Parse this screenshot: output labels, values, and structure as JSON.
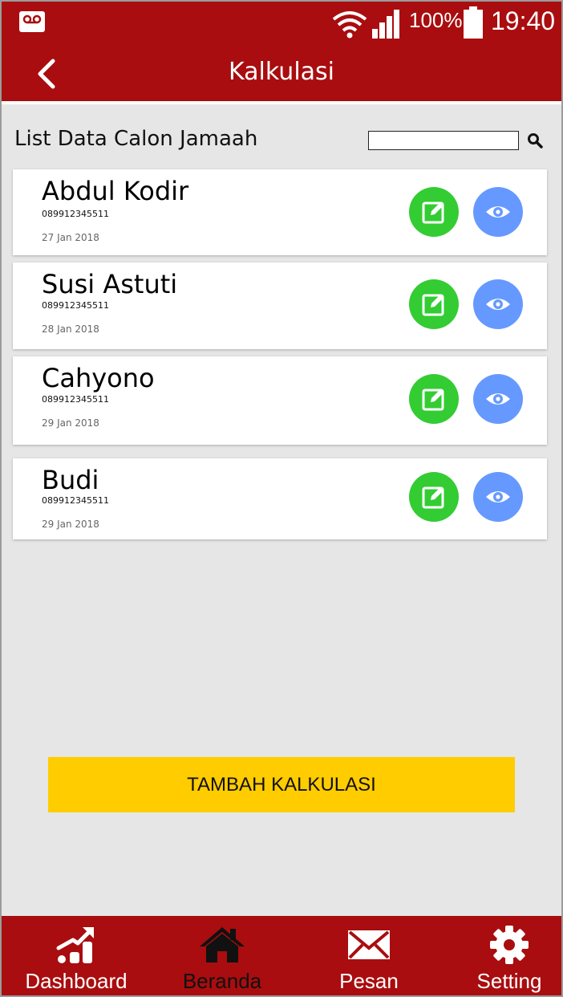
{
  "status_bar": {
    "battery": "100%",
    "time": "19:40",
    "icons": [
      "voicemail-icon",
      "wifi-icon",
      "signal-icon",
      "battery-icon"
    ]
  },
  "app_bar": {
    "title": "Kalkulasi",
    "back_icon": "chevron-left-icon"
  },
  "list": {
    "title": "List Data Calon Jamaah",
    "search_placeholder": "",
    "search_icon": "search-icon",
    "items": [
      {
        "name": "Abdul Kodir",
        "phone": "089912345511",
        "date": "27 Jan 2018"
      },
      {
        "name": "Susi Astuti",
        "phone": "089912345511",
        "date": "28 Jan 2018"
      },
      {
        "name": "Cahyono",
        "phone": "089912345511",
        "date": "29 Jan 2018"
      },
      {
        "name": "Budi",
        "phone": "089912345511",
        "date": "29 Jan 2018"
      }
    ],
    "edit_icon": "edit-icon",
    "view_icon": "eye-icon"
  },
  "actions": {
    "add_label": "TAMBAH KALKULASI"
  },
  "bottom_nav": {
    "items": [
      {
        "label": "Dashboard",
        "icon": "chart-icon"
      },
      {
        "label": "Beranda",
        "icon": "home-icon",
        "active": true
      },
      {
        "label": "Pesan",
        "icon": "mail-icon"
      },
      {
        "label": "Setting",
        "icon": "gear-icon"
      }
    ]
  },
  "colors": {
    "primary": "#a90d0f",
    "accent": "#ffcc00",
    "edit": "#33cc33",
    "view": "#6699ff",
    "background": "#e6e6e6"
  }
}
